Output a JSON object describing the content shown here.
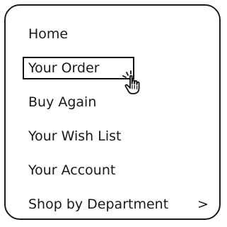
{
  "menu": {
    "items": [
      {
        "label": "Home"
      },
      {
        "label": "Your Order"
      },
      {
        "label": "Buy Again"
      },
      {
        "label": "Your Wish List"
      },
      {
        "label": "Your Account"
      },
      {
        "label": "Shop by Department"
      }
    ],
    "highlighted_index": 1,
    "submenu_indicator": ">"
  },
  "cursor": {
    "icon": "hand-pointer-icon"
  }
}
